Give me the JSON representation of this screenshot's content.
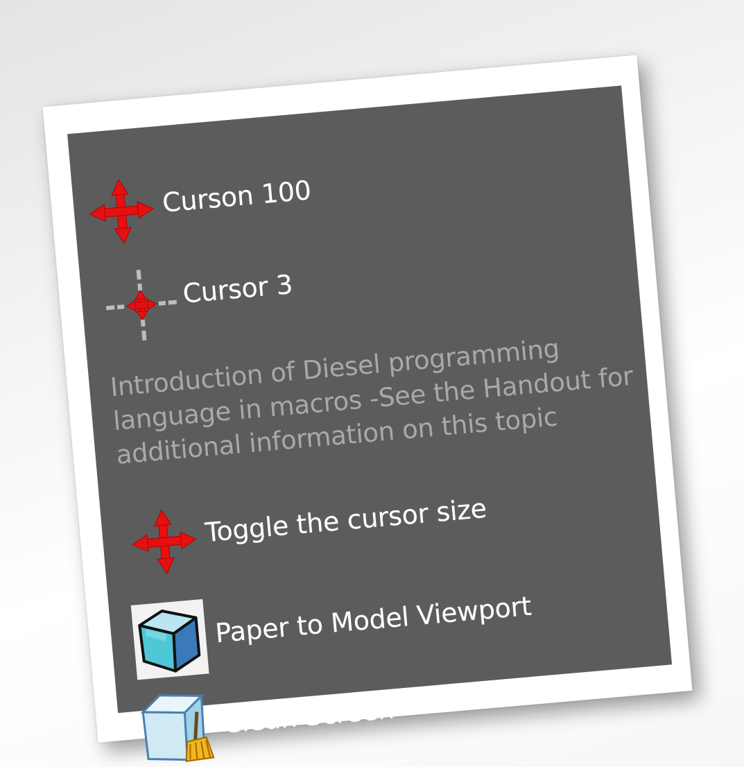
{
  "menu": {
    "items": [
      {
        "id": "cursor100",
        "label": "Curson 100",
        "icon": "move-cursor-large-icon"
      },
      {
        "id": "cursor3",
        "label": "Cursor 3",
        "icon": "move-cursor-small-icon"
      },
      {
        "id": "toggle",
        "label": "Toggle the cursor size",
        "icon": "move-cursor-large-icon"
      },
      {
        "id": "paper",
        "label": "Paper to Model Viewport",
        "icon": "3d-cube-icon"
      },
      {
        "id": "clean",
        "label": "Clean Screen",
        "icon": "clean-screen-broom-icon"
      }
    ],
    "description": "Introduction of Diesel programming language in macros -See the Handout for additional information on this topic"
  },
  "colors": {
    "panel_background": "#5c5c5c",
    "label_text": "#ffffff",
    "description_text": "#a9a9a9",
    "cursor_red": "#e61010",
    "frame": "#ffffff"
  }
}
